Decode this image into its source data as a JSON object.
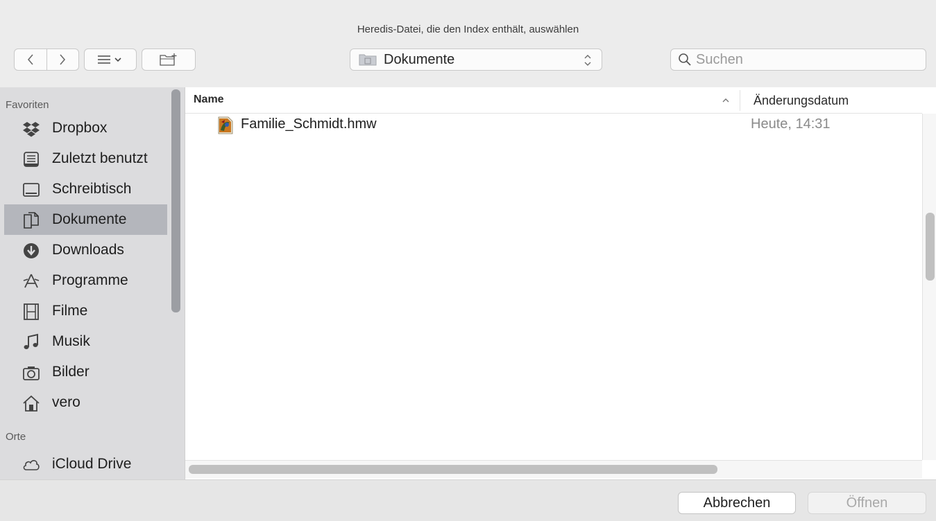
{
  "dialog": {
    "title": "Heredis-Datei, die den Index enthält, auswählen"
  },
  "toolbar": {
    "location_label": "Dokumente",
    "search_placeholder": "Suchen"
  },
  "sidebar": {
    "favorites_heading": "Favoriten",
    "favorites": [
      {
        "label": "Dropbox",
        "icon": "dropbox-icon"
      },
      {
        "label": "Zuletzt benutzt",
        "icon": "recents-icon"
      },
      {
        "label": "Schreibtisch",
        "icon": "desktop-icon"
      },
      {
        "label": "Dokumente",
        "icon": "documents-icon",
        "selected": true
      },
      {
        "label": "Downloads",
        "icon": "downloads-icon"
      },
      {
        "label": "Programme",
        "icon": "applications-icon"
      },
      {
        "label": "Filme",
        "icon": "movies-icon"
      },
      {
        "label": "Musik",
        "icon": "music-icon"
      },
      {
        "label": "Bilder",
        "icon": "pictures-icon"
      },
      {
        "label": "vero",
        "icon": "home-icon"
      }
    ],
    "places_heading": "Orte",
    "places": [
      {
        "label": "iCloud Drive",
        "icon": "cloud-icon"
      }
    ]
  },
  "filelist": {
    "columns": {
      "name": "Name",
      "date": "Änderungsdatum"
    },
    "rows": [
      {
        "name": "Familie_Schmidt.hmw",
        "date": "Heute, 14:31",
        "icon": "heredis-file-icon"
      }
    ]
  },
  "footer": {
    "cancel_label": "Abbrechen",
    "open_label": "Öffnen"
  },
  "colors": {
    "sidebar_bg": "#dcdcde",
    "selection": "#b4b6bc",
    "window_bg": "#ececec"
  }
}
